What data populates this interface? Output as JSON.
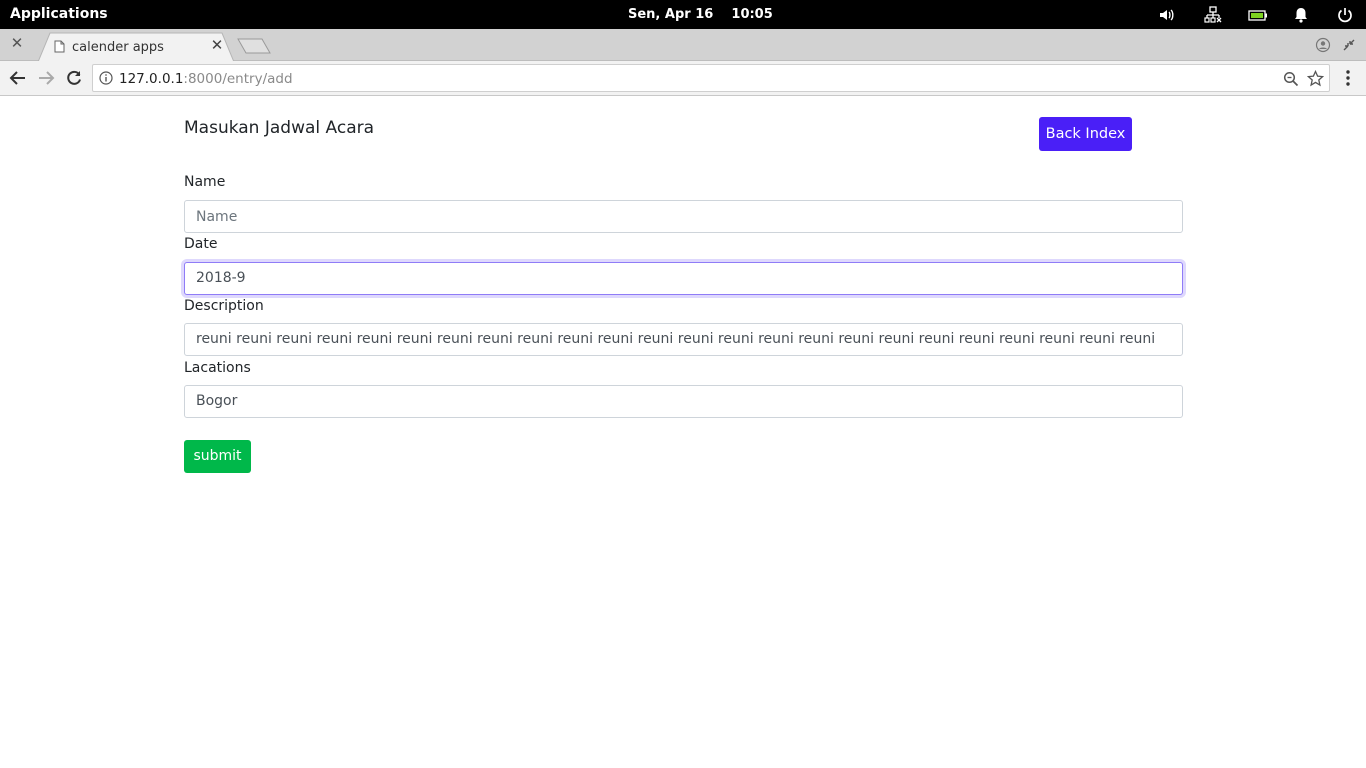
{
  "system_bar": {
    "applications_label": "Applications",
    "datetime": "Sen, Apr 16    10:05",
    "indicators": [
      "volume-icon",
      "network-icon",
      "battery-icon",
      "notification-bell-icon",
      "power-icon"
    ]
  },
  "browser": {
    "tab": {
      "title": "calender apps"
    },
    "url_host": "127.0.0.1",
    "url_rest": ":8000/entry/add"
  },
  "page": {
    "heading": "Masukan Jadwal Acara",
    "back_button_label": "Back Index",
    "form": {
      "name": {
        "label": "Name",
        "placeholder": "Name",
        "value": ""
      },
      "date": {
        "label": "Date",
        "value": "2018-9"
      },
      "description": {
        "label": "Description",
        "value": "reuni reuni reuni reuni reuni reuni reuni reuni reuni reuni reuni reuni reuni reuni reuni reuni reuni reuni reuni reuni reuni reuni reuni reuni"
      },
      "locations": {
        "label": "Lacations",
        "value": "Bogor"
      },
      "submit_label": "submit"
    }
  },
  "colors": {
    "back_button": "#4a1ff7",
    "submit_button": "#00b84a",
    "focus_ring": "#8f7cf7"
  }
}
